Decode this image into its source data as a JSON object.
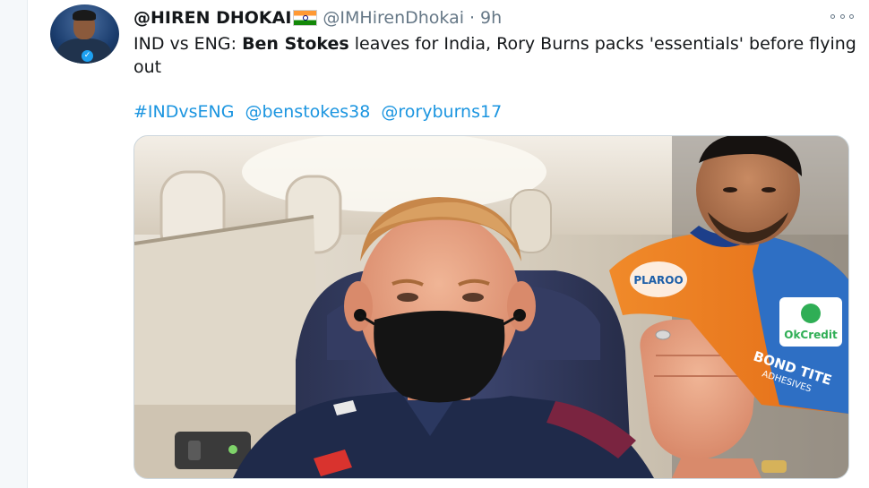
{
  "tweet": {
    "display_name": "@HIREN DHOKAI",
    "handle": "@IMHirenDhokai",
    "separator": "·",
    "time": "9h",
    "text_part1": "IND vs ENG: ",
    "text_bold": "Ben Stokes",
    "text_part2": " leaves for India, Rory Burns packs 'essentials' before flying out",
    "hashtag": "#INDvsENG",
    "mention1": "@benstokes38",
    "mention2": "@roryburns17"
  },
  "media": {
    "jersey_text": "OkCredit",
    "sponsor_text": "BOND TITE",
    "sponsor_sub": "ADHESIVES",
    "sponsor2": "PLAROO"
  },
  "colors": {
    "link": "#1b95e0",
    "text": "#14171a",
    "muted": "#657786"
  },
  "icons": {
    "more": "more-horizontal-icon",
    "flag": "india-flag-icon",
    "verified": "verified-badge-icon"
  }
}
